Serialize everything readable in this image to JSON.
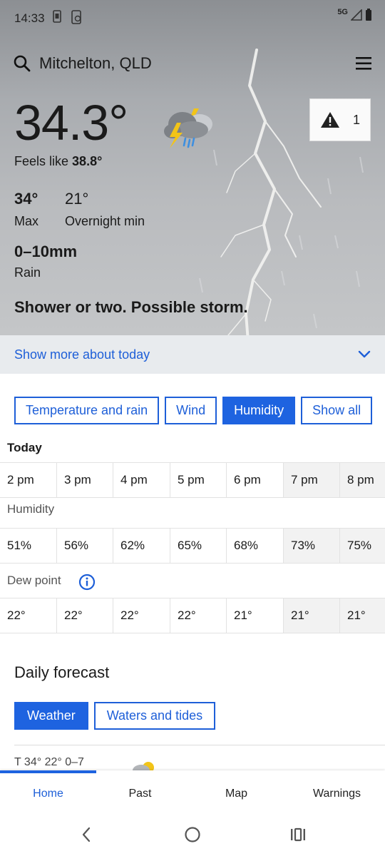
{
  "status": {
    "time": "14:33",
    "network": "5G"
  },
  "header": {
    "location": "Mitchelton, QLD"
  },
  "current": {
    "temperature": "34.3°",
    "feels_like_label": "Feels like",
    "feels_like_value": "38.8°",
    "warning_count": "1",
    "max_value": "34°",
    "max_label": "Max",
    "min_value": "21°",
    "min_label": "Overnight min",
    "rain_value": "0–10mm",
    "rain_label": "Rain",
    "summary": "Shower or two. Possible storm."
  },
  "show_more": {
    "label": "Show more about today"
  },
  "toggles": [
    "Temperature and rain",
    "Wind",
    "Humidity",
    "Show all"
  ],
  "toggles_active": "Humidity",
  "today_label": "Today",
  "hours": [
    "2 pm",
    "3 pm",
    "4 pm",
    "5 pm",
    "6 pm",
    "7 pm",
    "8 pm"
  ],
  "humidity_label": "Humidity",
  "humidity": [
    "51%",
    "56%",
    "62%",
    "65%",
    "68%",
    "73%",
    "75%"
  ],
  "dewpoint_label": "Dew point",
  "dewpoint": [
    "22°",
    "22°",
    "22°",
    "22°",
    "21°",
    "21°",
    "21°"
  ],
  "daily": {
    "title": "Daily forecast",
    "tabs": [
      "Weather",
      "Waters and tides"
    ],
    "peek_text": "T                                          34°  22°  0–7"
  },
  "nav": [
    "Home",
    "Past",
    "Map",
    "Warnings"
  ],
  "colors": {
    "accent": "#1e63e0",
    "link": "#1e5fd8"
  }
}
